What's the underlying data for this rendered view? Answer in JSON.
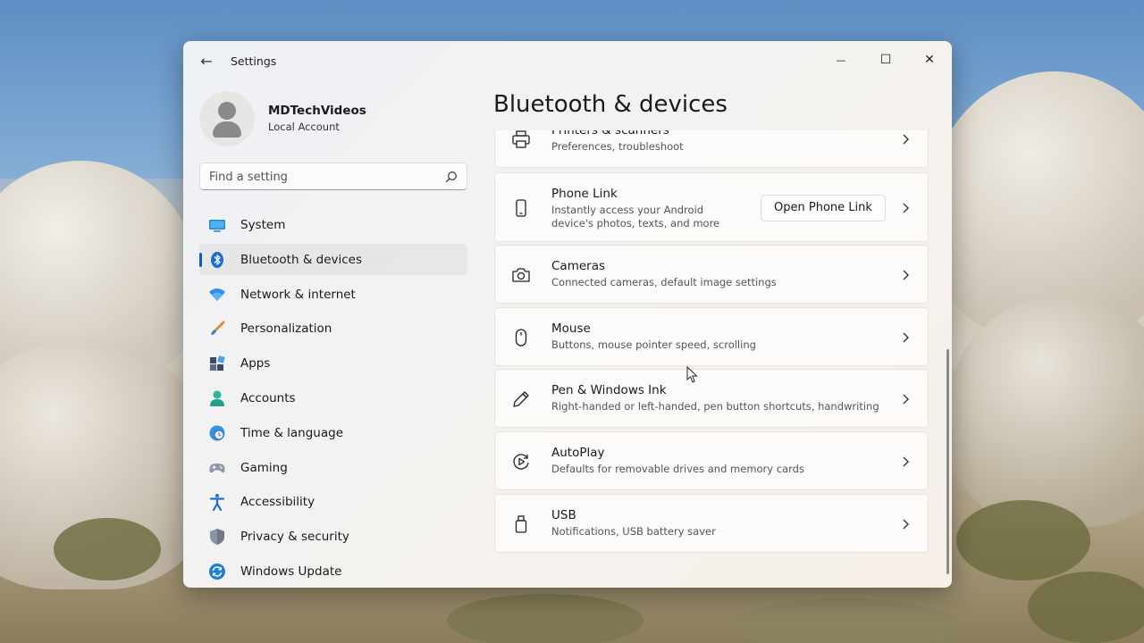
{
  "window": {
    "title": "Settings",
    "back_glyph": "←",
    "minimize_glyph": "—",
    "maximize_glyph": "☐",
    "close_glyph": "✕"
  },
  "profile": {
    "name": "MDTechVideos",
    "account_type": "Local Account"
  },
  "search": {
    "placeholder": "Find a setting"
  },
  "sidebar": {
    "items": [
      {
        "label": "System",
        "icon": "system-icon",
        "active": false
      },
      {
        "label": "Bluetooth & devices",
        "icon": "bluetooth-icon",
        "active": true
      },
      {
        "label": "Network & internet",
        "icon": "wifi-icon",
        "active": false
      },
      {
        "label": "Personalization",
        "icon": "brush-icon",
        "active": false
      },
      {
        "label": "Apps",
        "icon": "apps-icon",
        "active": false
      },
      {
        "label": "Accounts",
        "icon": "accounts-icon",
        "active": false
      },
      {
        "label": "Time & language",
        "icon": "globe-clock-icon",
        "active": false
      },
      {
        "label": "Gaming",
        "icon": "gamepad-icon",
        "active": false
      },
      {
        "label": "Accessibility",
        "icon": "accessibility-icon",
        "active": false
      },
      {
        "label": "Privacy & security",
        "icon": "shield-icon",
        "active": false
      },
      {
        "label": "Windows Update",
        "icon": "update-icon",
        "active": false
      }
    ]
  },
  "main": {
    "title": "Bluetooth & devices",
    "cards": [
      {
        "title": "Printers & scanners",
        "subtitle": "Preferences, troubleshoot",
        "icon": "printer-icon"
      },
      {
        "title": "Phone Link",
        "subtitle": "Instantly access your Android",
        "subtitle2": "device's photos, texts, and more",
        "button": "Open Phone Link",
        "icon": "phone-icon"
      },
      {
        "title": "Cameras",
        "subtitle": "Connected cameras, default image settings",
        "icon": "camera-icon"
      },
      {
        "title": "Mouse",
        "subtitle": "Buttons, mouse pointer speed, scrolling",
        "icon": "mouse-icon"
      },
      {
        "title": "Pen & Windows Ink",
        "subtitle": "Right-handed or left-handed, pen button shortcuts, handwriting",
        "icon": "pen-icon"
      },
      {
        "title": "AutoPlay",
        "subtitle": "Defaults for removable drives and memory cards",
        "icon": "autoplay-icon"
      },
      {
        "title": "USB",
        "subtitle": "Notifications, USB battery saver",
        "icon": "usb-icon"
      }
    ]
  },
  "colors": {
    "accent": "#0a5fc4"
  }
}
